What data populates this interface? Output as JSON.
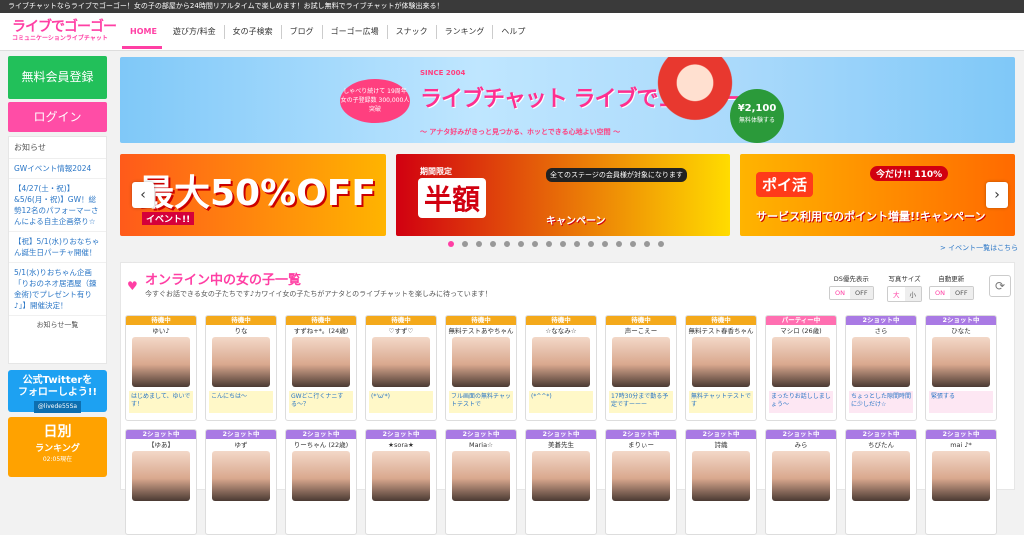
{
  "topbar": {
    "text": "ライブチャットならライブでゴーゴー！女の子の部屋から24時間リアルタイムで楽しめます！お試し無料でライブチャットが体験出来る！"
  },
  "logo": {
    "line1": "ライブでゴーゴー",
    "line2": "コミュニケーションライブチャット"
  },
  "nav": {
    "items": [
      "HOME",
      "遊び方/料金",
      "女の子検索",
      "ブログ",
      "ゴーゴー広場",
      "スナック",
      "ランキング",
      "ヘルプ"
    ]
  },
  "sidebar": {
    "register": "無料会員登録",
    "login": "ログイン",
    "news_heading": "お知らせ",
    "news": [
      "GWイベント情報2024",
      "【4/27(土・祝)】&5/6(月・祝)】GW！総勢12名のパフォーマーさんによる自主企画祭り☆",
      "【祝】5/1(水)りおなちゃん誕生日パーチャ開催！",
      "5/1(水)りおちゃん企画「りおのネオ居酒屋（錬金術)でプレゼント有り♪」】開催決定！"
    ],
    "news_more": "お知らせ一覧",
    "twitter_line1": "公式Twitterを",
    "twitter_line2": "フォローしよう!!",
    "twitter_handle": "@livede55Sa",
    "rank_title": "日別",
    "rank_sub": "ランキング",
    "rank_time": "02:05現在"
  },
  "banner": {
    "since": "SINCE 2004",
    "title": "ライブチャット ライブでゴーゴー",
    "badge": "しゃべり続けて 19周年 女の子登録数 300,000人突破",
    "price": "¥2,100",
    "price_note": "無料体験する",
    "sub": "〜 アナタ好みがきっと見つかる、ホッとできる心地よい空間 〜"
  },
  "carousel": {
    "slide1_big": "最大50%OFF",
    "slide1_sub": "イベント!!",
    "slide2_tag": "期間限定",
    "slide2_big": "半額",
    "slide2_note": "全てのステージの会員様が対象になります",
    "slide2_sub": "キャンペーン",
    "slide3_a": "ポイ活",
    "slide3_b": "今だけ!! 110%",
    "slide3_c": "サービス利用でのポイント増量!!キャンペーン",
    "event_list": "> イベント一覧はこちら",
    "dots": 16,
    "active_dot": 0
  },
  "online": {
    "title": "オンライン中の女の子一覧",
    "subtitle": "今すぐお話できる女の子たちです♪カワイイ女の子たちがアナタとのライブチャットを楽しみに待っています！",
    "toggles": [
      {
        "label": "DS優先表示",
        "on": "ON",
        "off": "OFF",
        "selected": "ON"
      },
      {
        "label": "写真サイズ",
        "on": "大",
        "off": "小",
        "selected": "大"
      },
      {
        "label": "自動更新",
        "on": "ON",
        "off": "OFF",
        "selected": "ON"
      }
    ],
    "cards_row1": [
      {
        "status": "待機中",
        "kind": "wait",
        "name": "ゆい♪",
        "msg": "はじめまして、ゆいです！",
        "pink": false
      },
      {
        "status": "待機中",
        "kind": "wait",
        "name": "りな",
        "msg": "こんにちは〜",
        "pink": false
      },
      {
        "status": "待機中",
        "kind": "wait",
        "name": "すずね+*。(24歳)",
        "msg": "GWどこ行くナニする〜？",
        "pink": false
      },
      {
        "status": "待機中",
        "kind": "wait",
        "name": "♡すず♡",
        "msg": "(*'ω'*)",
        "pink": false
      },
      {
        "status": "待機中",
        "kind": "wait",
        "name": "無料テストあやちゃん",
        "msg": "フル画面の無料チャットテストで",
        "pink": false
      },
      {
        "status": "待機中",
        "kind": "wait",
        "name": "☆ななみ☆",
        "msg": "(*^^*)",
        "pink": false
      },
      {
        "status": "待機中",
        "kind": "wait",
        "name": "声ーこえー",
        "msg": "17時30分まで勤る予定ですーーー",
        "pink": false
      },
      {
        "status": "待機中",
        "kind": "wait",
        "name": "無料テスト春香ちゃん",
        "msg": "無料チャットテストです",
        "pink": false
      },
      {
        "status": "パーティー中",
        "kind": "party",
        "name": "マシロ (26歳)",
        "msg": "まったりお話ししましょう〜",
        "pink": true
      },
      {
        "status": "2ショット中",
        "kind": "two",
        "name": "さら",
        "msg": "ちょっとした隙間時間に少しだけ☆",
        "pink": true
      },
      {
        "status": "2ショット中",
        "kind": "two",
        "name": "ひなた",
        "msg": "緊張する",
        "pink": true
      }
    ],
    "cards_row2": [
      {
        "status": "2ショット中",
        "kind": "two",
        "name": "【ゆあ】"
      },
      {
        "status": "2ショット中",
        "kind": "two",
        "name": "ゆず"
      },
      {
        "status": "2ショット中",
        "kind": "two",
        "name": "りーちゃん (22歳)"
      },
      {
        "status": "2ショット中",
        "kind": "two",
        "name": "★sora★"
      },
      {
        "status": "2ショット中",
        "kind": "two",
        "name": "Maria☆"
      },
      {
        "status": "2ショット中",
        "kind": "two",
        "name": "美碁先生"
      },
      {
        "status": "2ショット中",
        "kind": "two",
        "name": "まりぃー"
      },
      {
        "status": "2ショット中",
        "kind": "two",
        "name": "詩織"
      },
      {
        "status": "2ショット中",
        "kind": "two",
        "name": "みら"
      },
      {
        "status": "2ショット中",
        "kind": "two",
        "name": "ちびたん"
      },
      {
        "status": "2ショット中",
        "kind": "two",
        "name": "mai ♪*"
      }
    ]
  }
}
